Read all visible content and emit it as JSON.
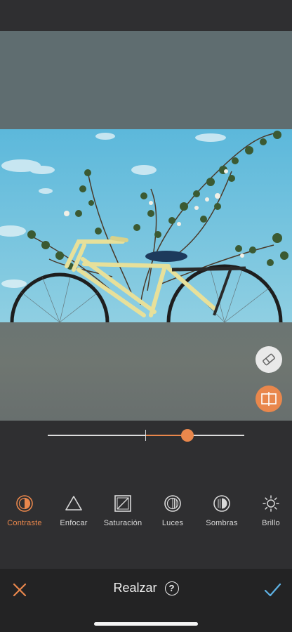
{
  "editor": {
    "title": "Realzar",
    "help_symbol": "?"
  },
  "adjustment": {
    "value": 0.71
  },
  "tools": [
    {
      "label": "Contraste",
      "icon": "contrast-icon",
      "active": true
    },
    {
      "label": "Enfocar",
      "icon": "sharpen-icon",
      "active": false
    },
    {
      "label": "Saturación",
      "icon": "saturation-icon",
      "active": false
    },
    {
      "label": "Luces",
      "icon": "highlights-icon",
      "active": false
    },
    {
      "label": "Sombras",
      "icon": "shadows-icon",
      "active": false
    },
    {
      "label": "Brillo",
      "icon": "brightness-icon",
      "active": false
    }
  ],
  "colors": {
    "accent": "#e9874c",
    "confirm": "#5fb3e6",
    "toolbar_bg": "#2f2f31"
  }
}
